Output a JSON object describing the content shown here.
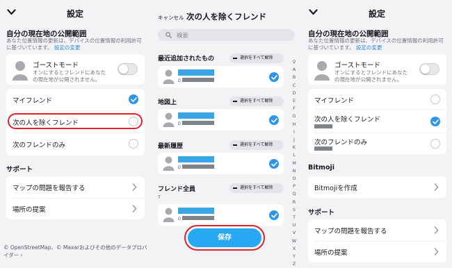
{
  "left": {
    "title": "設定",
    "section_location": "自分の現在地の公開範囲",
    "desc_text": "あなた位置情報の更新は、デバイスの位置情報の利用許可に基づいています。",
    "desc_link": "設定の変更",
    "ghost_title": "ゴーストモード",
    "ghost_desc": "オンにするとフレンドにあなたの現在地が公開されません。",
    "options": [
      "マイフレンド",
      "次の人を除くフレンド",
      "次のフレンドのみ"
    ],
    "selected_index": 0,
    "support_title": "サポート",
    "support_items": [
      "マップの問題を報告する",
      "場所の提案"
    ],
    "footer": "© OpenStreetMap、© Maxarおよびその他のデータプロバイダー ›"
  },
  "middle": {
    "cancel": "キャンセル",
    "title": "次の人を除くフレンド",
    "search_placeholder": "検索",
    "select_all": "選択をすべて解除",
    "groups": [
      "最近追加されたもの",
      "地図上",
      "最新履歴",
      "フレンド全員"
    ],
    "subheader": "T",
    "alphabet": "♀ A B C D E F G H I J K L M N O P Q R S T U V W X Y Z",
    "save": "保存"
  },
  "right": {
    "title": "設定",
    "section_location": "自分の現在地の公開範囲",
    "desc_text": "あなた位置情報の更新は、デバイスの位置情報の利用許可に基づいています。",
    "desc_link": "設定の変更",
    "ghost_title": "ゴーストモード",
    "ghost_desc": "オンにするとフレンドにあなたの現在地が公開されません。",
    "options": [
      "マイフレンド",
      "次の人を除くフレンド",
      "次のフレンドのみ"
    ],
    "selected_index": 1,
    "bitmoji_title": "Bitmoji",
    "bitmoji_item": "Bitmojiを作成",
    "support_title": "サポート",
    "support_items": [
      "マップの問題を報告する",
      "場所の提案"
    ]
  },
  "colors": {
    "accent": "#2f96e6",
    "highlight": "#e0202a",
    "save": "#26a8f2"
  },
  "icons": [
    "chevron-down-icon",
    "ghost-avatar-icon",
    "checkmark-icon",
    "chevron-right-icon",
    "search-icon",
    "location-pin-icon"
  ]
}
